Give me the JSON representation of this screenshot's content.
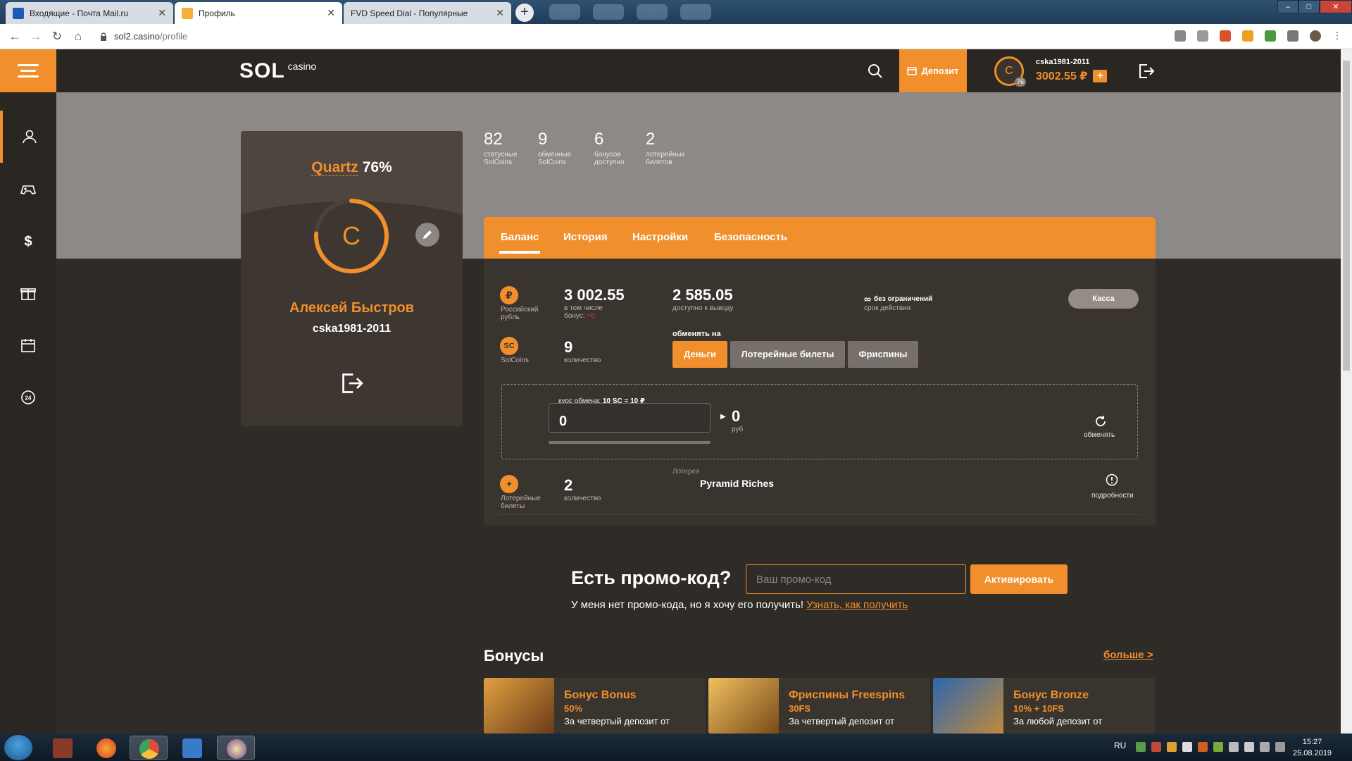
{
  "browser": {
    "tabs": [
      {
        "title": "Входящие - Почта Mail.ru",
        "active": false
      },
      {
        "title": "Профиль",
        "active": true
      },
      {
        "title": "FVD Speed Dial - Популярные",
        "active": false
      }
    ],
    "url_host": "sol2.casino",
    "url_path": "/profile"
  },
  "header": {
    "logo_main": "SOL",
    "logo_sub": "casino",
    "deposit_label": "Депозит",
    "username": "cska1981-2011",
    "balance": "3002.55 ₽",
    "avatar_letter": "C",
    "avatar_level": "76",
    "plus_label": "+"
  },
  "sidebar": {
    "items": [
      {
        "icon": "user-icon",
        "active": true
      },
      {
        "icon": "gamepad-icon",
        "active": false
      },
      {
        "icon": "dollar-icon",
        "active": false
      },
      {
        "icon": "gift-icon",
        "active": false
      },
      {
        "icon": "calendar-icon",
        "active": false
      },
      {
        "icon": "support-24-icon",
        "active": false
      }
    ]
  },
  "profile_card": {
    "status_name": "Quartz",
    "status_percent": "76%",
    "status_progress": 0.76,
    "avatar_letter": "C",
    "full_name": "Алексей Быстров",
    "login": "cska1981-2011"
  },
  "stats": [
    {
      "value": "82",
      "label": "статусные SolCoins"
    },
    {
      "value": "9",
      "label": "обменные SolCoins"
    },
    {
      "value": "6",
      "label": "бонусов доступно"
    },
    {
      "value": "2",
      "label": "лотерейных билетов"
    }
  ],
  "tabs": [
    "Баланс",
    "История",
    "Настройки",
    "Безопасность"
  ],
  "balance": {
    "rub": {
      "icon_glyph": "₽",
      "label": "Российский рубль",
      "total": "3 002.55",
      "total_note_1": "в том числе",
      "total_note_2": "бонус: ",
      "bonus_value": "+0",
      "withdraw": "2 585.05",
      "withdraw_note": "доступно к выводу",
      "validity_value": "без ограничений",
      "validity_note": "срок действия",
      "cashier_button": "Касса"
    },
    "solcoins": {
      "icon_glyph": "SC",
      "label": "SolCoins",
      "count": "9",
      "count_note": "количество",
      "exchange_caption": "обменять на",
      "exchange_options": [
        "Деньги",
        "Лотерейные билеты",
        "Фриспины"
      ]
    },
    "exchange": {
      "rate_caption": "курс обмена: ",
      "rate_value": "10 SC = 10 ₽",
      "input_value": "0",
      "result_value": "0",
      "result_unit": "руб",
      "swap_label": "обменять"
    },
    "lottery": {
      "label": "Лотерейные билеты",
      "count": "2",
      "count_note": "количество",
      "lottery_caption": "Лотерея",
      "lottery_name": "Pyramid Riches",
      "details_label": "подробности"
    }
  },
  "promo": {
    "title": "Есть промо-код?",
    "placeholder": "Ваш промо-код",
    "button": "Активировать",
    "note": "У меня нет промо-кода, но я хочу его получить! ",
    "link": "Узнать, как получить"
  },
  "bonuses": {
    "title": "Бонусы",
    "more": "больше >",
    "items": [
      {
        "title": "Бонус Bonus",
        "value": "50%",
        "desc": "За четвертый депозит от"
      },
      {
        "title": "Фриспины Freespins",
        "value": "30FS",
        "desc": "За четвертый депозит от"
      },
      {
        "title": "Бонус Bronze",
        "value": "10% + 10FS",
        "desc": "За любой депозит от"
      }
    ]
  },
  "taskbar": {
    "lang": "RU",
    "time": "15:27",
    "date": "25.08.2019"
  },
  "colors": {
    "accent": "#f08f2c",
    "panel": "#3a342f",
    "background": "#2f2b27"
  }
}
